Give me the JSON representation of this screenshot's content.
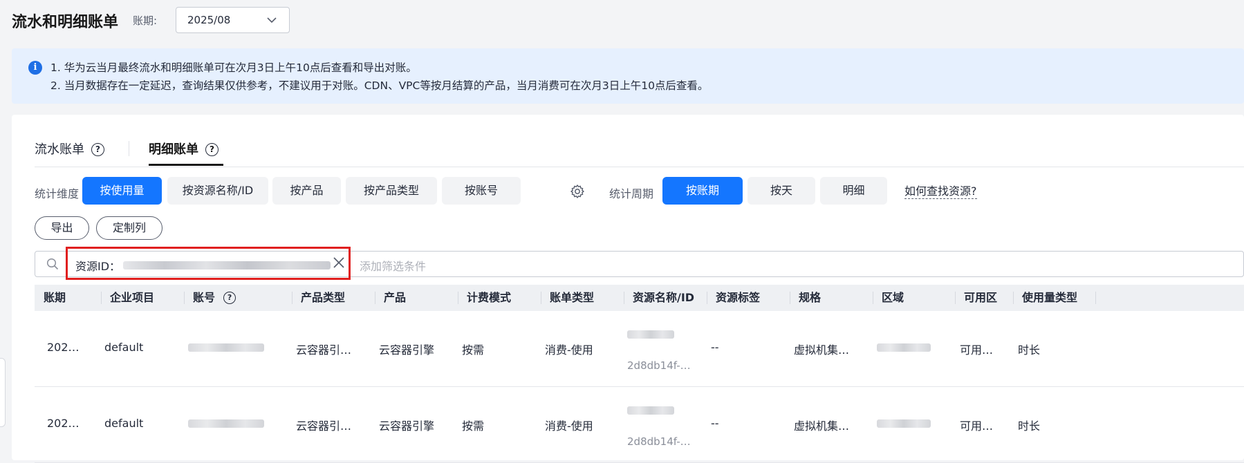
{
  "header": {
    "title": "流水和明细账单",
    "period_label": "账期:",
    "period_value": "2025/08"
  },
  "notice": {
    "line1": "1. 华为云当月最终流水和明细账单可在次月3日上午10点后查看和导出对账。",
    "line2": "2. 当月数据存在一定延迟，查询结果仅供参考，不建议用于对账。CDN、VPC等按月结算的产品，当月消费可在次月3日上午10点后查看。"
  },
  "tabs": [
    {
      "label": "流水账单",
      "active": false
    },
    {
      "label": "明细账单",
      "active": true
    }
  ],
  "dimension": {
    "label": "统计维度",
    "options": [
      "按使用量",
      "按资源名称/ID",
      "按产品",
      "按产品类型",
      "按账号"
    ],
    "selected": "按使用量"
  },
  "cycle": {
    "label": "统计周期",
    "options": [
      "按账期",
      "按天",
      "明细"
    ],
    "selected": "按账期"
  },
  "help_link": "如何查找资源?",
  "actions": {
    "export": "导出",
    "customize_columns": "定制列"
  },
  "search": {
    "chip_label": "资源ID：",
    "placeholder": "添加筛选条件"
  },
  "table": {
    "columns": [
      "账期",
      "企业项目",
      "账号",
      "产品类型",
      "产品",
      "计费模式",
      "账单类型",
      "资源名称/ID",
      "资源标签",
      "规格",
      "区域",
      "可用区",
      "使用量类型"
    ],
    "rows": [
      {
        "period": "202…",
        "enterprise_project": "default",
        "product_type": "云容器引…",
        "product": "云容器引擎",
        "billing_mode": "按需",
        "bill_type": "消费-使用",
        "resource_id": "2d8db14f-…",
        "resource_tag": "--",
        "spec": "虚拟机集…",
        "az": "可用…",
        "usage_type": "时长"
      },
      {
        "period": "202…",
        "enterprise_project": "default",
        "product_type": "云容器引…",
        "product": "云容器引擎",
        "billing_mode": "按需",
        "bill_type": "消费-使用",
        "resource_id": "2d8db14f-…",
        "resource_tag": "--",
        "spec": "虚拟机集…",
        "az": "可用…",
        "usage_type": "时长"
      }
    ]
  },
  "colors": {
    "primary": "#1476ff",
    "highlight_border": "#e01f1f",
    "notice_bg": "#e6f0fe"
  }
}
